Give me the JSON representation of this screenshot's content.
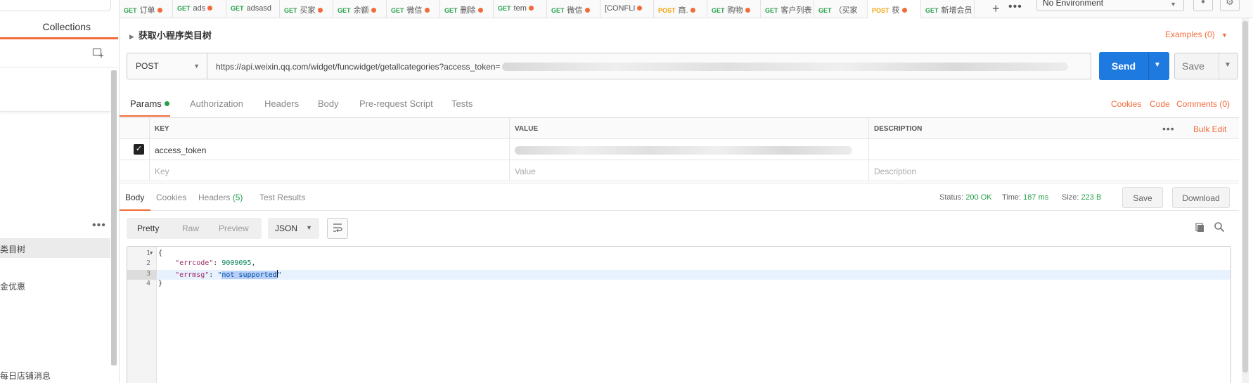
{
  "sidebar": {
    "tab_label": "Collections",
    "more_label": "•••",
    "items": [
      {
        "label": "类目树",
        "active": true
      },
      {
        "label": "金优惠",
        "active": false
      },
      {
        "label": "每日店铺消息",
        "active": false
      }
    ]
  },
  "tabs": [
    {
      "method": "GET",
      "name": "订单",
      "dot": true
    },
    {
      "method": "GET",
      "name": "ads",
      "dot": true
    },
    {
      "method": "GET",
      "name": "adsasd",
      "dot": false
    },
    {
      "method": "GET",
      "name": "买家",
      "dot": true
    },
    {
      "method": "GET",
      "name": "余额",
      "dot": true
    },
    {
      "method": "GET",
      "name": "微信",
      "dot": true
    },
    {
      "method": "GET",
      "name": "删除",
      "dot": true
    },
    {
      "method": "GET",
      "name": "tem",
      "dot": true
    },
    {
      "method": "GET",
      "name": "微信",
      "dot": true
    },
    {
      "method": "",
      "name": "[CONFLI",
      "dot": true
    },
    {
      "method": "POST",
      "name": "商.",
      "dot": true
    },
    {
      "method": "GET",
      "name": "购物",
      "dot": true
    },
    {
      "method": "GET",
      "name": "客户列表",
      "dot": false
    },
    {
      "method": "GET",
      "name": "（买家",
      "dot": false
    },
    {
      "method": "POST",
      "name": "获",
      "dot": true
    },
    {
      "method": "GET",
      "name": "新增会员",
      "dot": false
    }
  ],
  "tab_plus": "+",
  "tab_more": "•••",
  "environment": {
    "selected": "No Environment"
  },
  "request": {
    "name": "获取小程序类目树",
    "examples_label": "Examples (0)",
    "method": "POST",
    "url": "https://api.weixin.qq.com/widget/funcwidget/getallcategories?access_token=",
    "send_label": "Send",
    "save_label": "Save"
  },
  "request_tabs": {
    "items": [
      "Params",
      "Authorization",
      "Headers",
      "Body",
      "Pre-request Script",
      "Tests"
    ],
    "active": "Params",
    "right_links": [
      "Cookies",
      "Code",
      "Comments (0)"
    ]
  },
  "params": {
    "headers": [
      "KEY",
      "VALUE",
      "DESCRIPTION"
    ],
    "bulk_edit": "Bulk Edit",
    "rows": [
      {
        "checked": true,
        "key": "access_token",
        "value": "",
        "description": ""
      }
    ],
    "placeholders": {
      "key": "Key",
      "value": "Value",
      "description": "Description"
    }
  },
  "response": {
    "tabs": [
      "Body",
      "Cookies",
      "Headers",
      "Test Results"
    ],
    "headers_count": "(5)",
    "active": "Body",
    "status_label": "Status:",
    "status_value": "200 OK",
    "time_label": "Time:",
    "time_value": "187 ms",
    "size_label": "Size:",
    "size_value": "223 B",
    "save_label": "Save",
    "download_label": "Download",
    "formats": [
      "Pretty",
      "Raw",
      "Preview"
    ],
    "active_format": "Pretty",
    "language": "JSON",
    "code_lines": [
      "{",
      "    \"errcode\": 9009095,",
      "    \"errmsg\": \"not supported\"",
      "}"
    ],
    "errcode": "9009095",
    "errmsg": "not supported"
  },
  "colors": {
    "accent": "#f26b3a",
    "send": "#1f7ae0",
    "get": "#24a148",
    "post": "#f4a000",
    "success": "#24a148"
  }
}
